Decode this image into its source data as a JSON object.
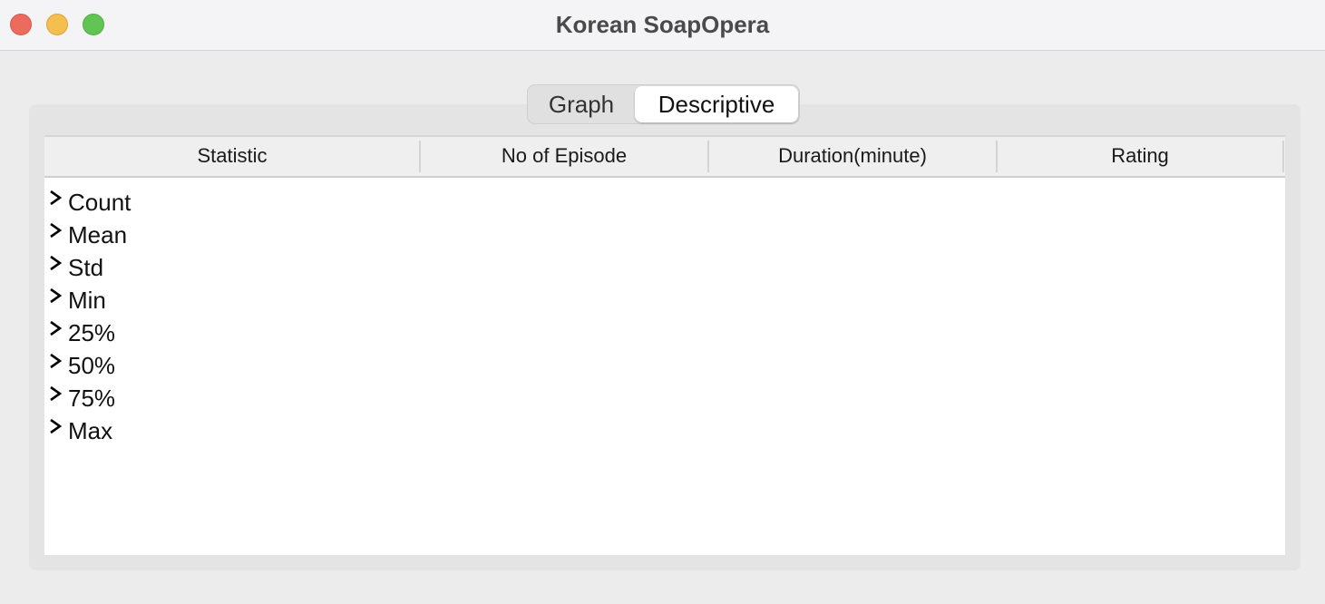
{
  "window": {
    "title": "Korean SoapOpera"
  },
  "tabs": [
    {
      "label": "Graph",
      "selected": false
    },
    {
      "label": "Descriptive",
      "selected": true
    }
  ],
  "table": {
    "columns": [
      "Statistic",
      "No of Episode",
      "Duration(minute)",
      "Rating"
    ],
    "rows": [
      {
        "label": "Count",
        "expander": "chevron-right-icon"
      },
      {
        "label": "Mean",
        "expander": "chevron-right-icon"
      },
      {
        "label": "Std",
        "expander": "chevron-right-icon"
      },
      {
        "label": "Min",
        "expander": "chevron-right-icon"
      },
      {
        "label": "25%",
        "expander": "chevron-right-icon"
      },
      {
        "label": "50%",
        "expander": "chevron-right-icon"
      },
      {
        "label": "75%",
        "expander": "chevron-right-icon"
      },
      {
        "label": "Max",
        "expander": "chevron-right-icon"
      }
    ]
  },
  "colors": {
    "close": "#ec6a5e",
    "minimize": "#f4bf4f",
    "maximize": "#61c554"
  }
}
